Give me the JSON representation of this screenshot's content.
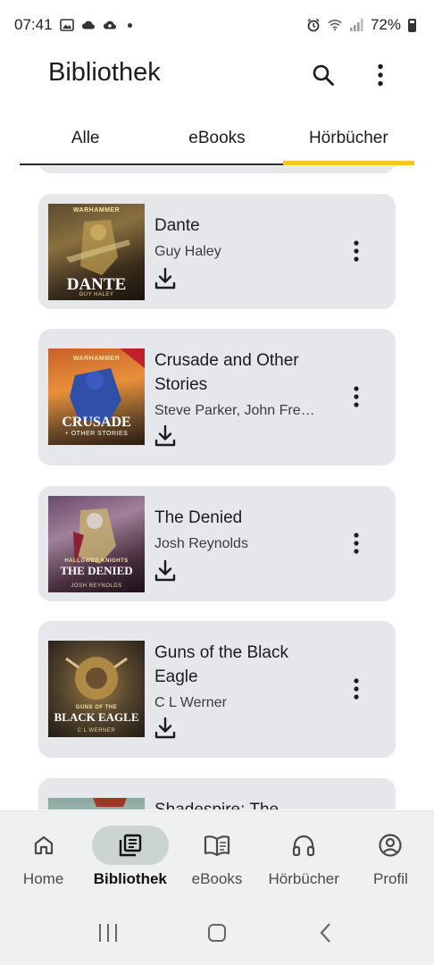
{
  "status_bar": {
    "time": "07:41",
    "battery": "72%"
  },
  "app_bar": {
    "title": "Bibliothek"
  },
  "tabs": [
    {
      "label": "Alle",
      "active": false
    },
    {
      "label": "eBooks",
      "active": false
    },
    {
      "label": "Hörbücher",
      "active": true
    }
  ],
  "colors": {
    "accent": "#f5c518",
    "card_bg": "#e5e7ea",
    "nav_active_bg": "#cbd3d3"
  },
  "books": [
    {
      "title": "Dante",
      "author": "Guy Haley",
      "cover": {
        "top": "WARHAMMER",
        "name": "DANTE",
        "sub": "GUY HALEY"
      }
    },
    {
      "title": "Crusade and Other Stories",
      "author": "Steve Parker, John French, ...",
      "cover": {
        "top": "WARHAMMER",
        "name": "CRUSADE",
        "sub": "+ OTHER STORIES"
      }
    },
    {
      "title": "The Denied",
      "author": "Josh Reynolds",
      "cover": {
        "top": "HALLOWED KNIGHTS",
        "name": "THE DENIED",
        "sub": "JOSH REYNOLDS"
      }
    },
    {
      "title": "Guns of the Black Eagle",
      "author": "C L Werner",
      "cover": {
        "top": "GUNS OF THE",
        "name": "BLACK EAGLE",
        "sub": "C L WERNER"
      }
    },
    {
      "title": "Shadespire: The",
      "author": "",
      "cover": {
        "top": "",
        "name": "",
        "sub": ""
      }
    }
  ],
  "bottom_nav": [
    {
      "label": "Home",
      "icon": "home-icon",
      "active": false
    },
    {
      "label": "Bibliothek",
      "icon": "library-icon",
      "active": true
    },
    {
      "label": "eBooks",
      "icon": "book-icon",
      "active": false
    },
    {
      "label": "Hörbücher",
      "icon": "headphones-icon",
      "active": false
    },
    {
      "label": "Profil",
      "icon": "profile-icon",
      "active": false
    }
  ]
}
